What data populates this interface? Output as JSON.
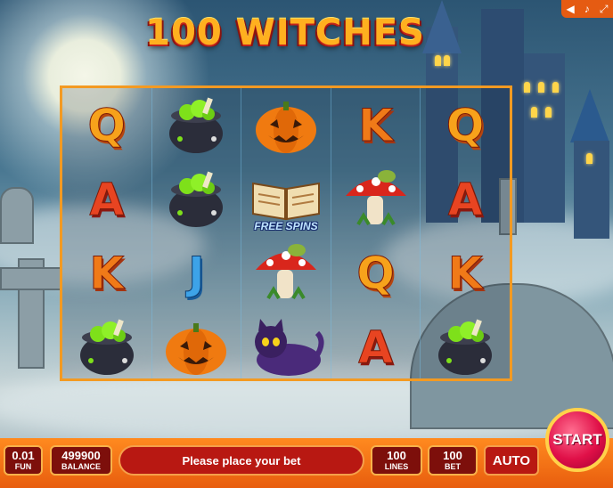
{
  "title": "100 WITCHES",
  "sound": {
    "settings_icon": "menu-icon",
    "sound_icon": "speaker-icon",
    "music_icon": "music-note-icon",
    "fullscreen_icon": "fullscreen-icon"
  },
  "reels": [
    [
      "Q",
      "A",
      "K",
      "cauldron"
    ],
    [
      "cauldron",
      "cauldron",
      "J",
      "pumpkin"
    ],
    [
      "pumpkin",
      "free-spins-book",
      "mushroom",
      "black-cat"
    ],
    [
      "K",
      "mushroom",
      "Q",
      "A"
    ],
    [
      "Q",
      "A",
      "K",
      "cauldron"
    ]
  ],
  "free_spins_label": "FREE SPINS",
  "bottom": {
    "fun_value": "0.01",
    "fun_label": "FUN",
    "balance_value": "499900",
    "balance_label": "BALANCE",
    "message": "Please place your bet",
    "lines_value": "100",
    "lines_label": "LINES",
    "bet_value": "100",
    "bet_label": "BET",
    "auto_label": "AUTO",
    "start_label": "START"
  },
  "colors": {
    "accent": "#f39a22",
    "bar": "#e85d0e",
    "start": "#e01048"
  }
}
